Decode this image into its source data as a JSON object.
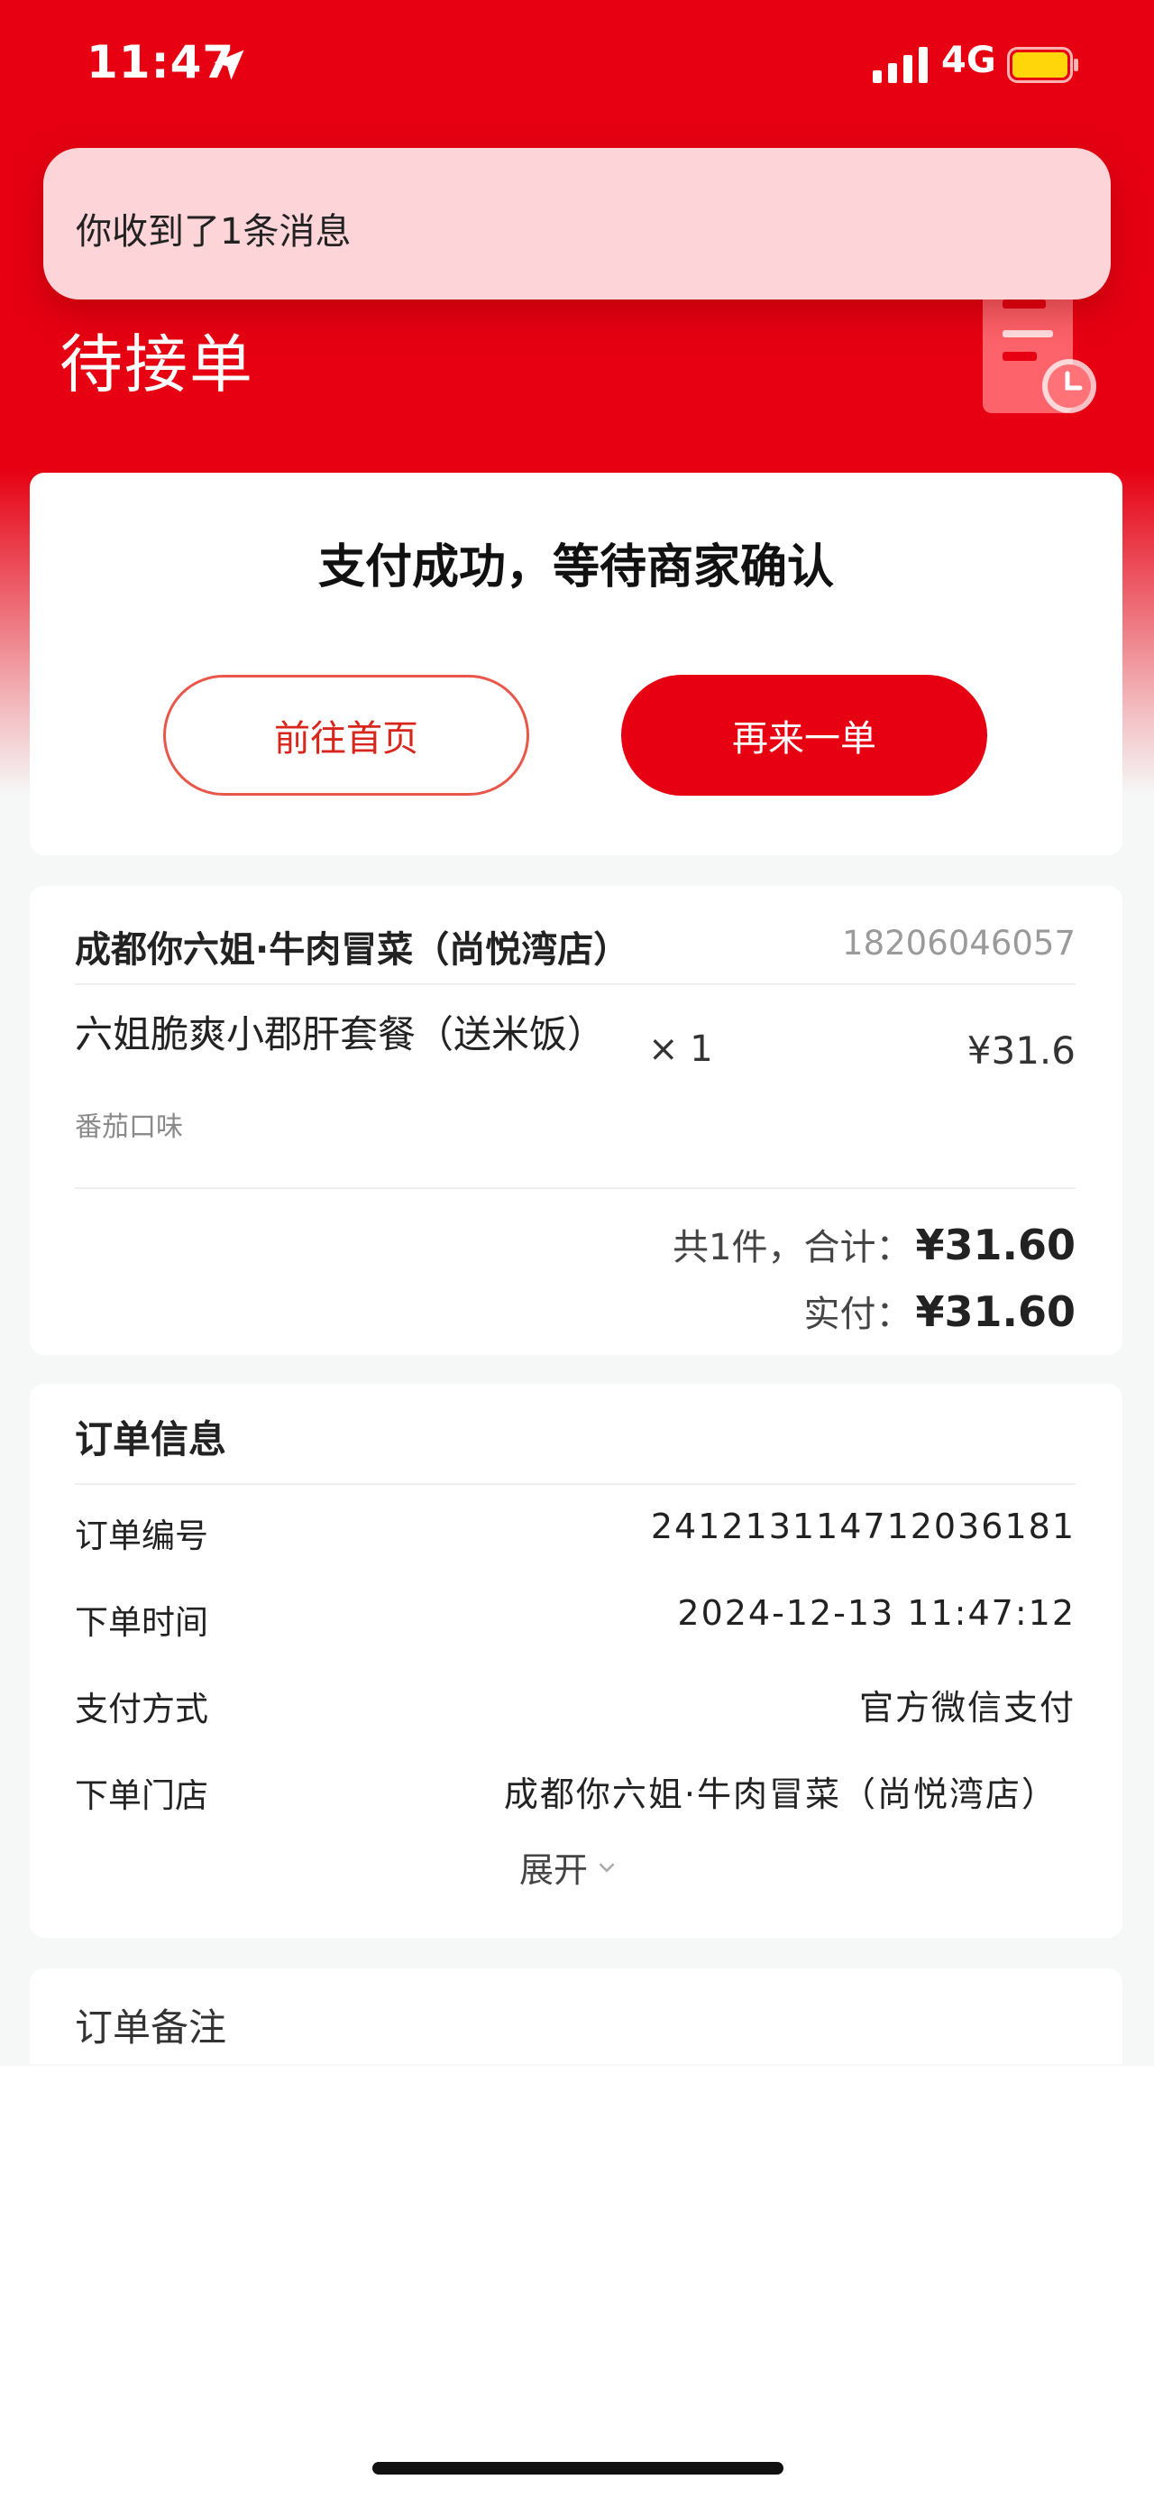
{
  "status_bar": {
    "time": "11:47",
    "network": "4G"
  },
  "notification": {
    "text": "你收到了1条消息"
  },
  "header": {
    "title": "待接单"
  },
  "result_card": {
    "message": "支付成功，等待商家确认",
    "home_button": "前往首页",
    "reorder_button": "再来一单"
  },
  "order_card": {
    "store_name": "成都你六姐·牛肉冒菜（尚悦湾店）",
    "store_phone": "18206046057",
    "items": [
      {
        "name": "六姐脆爽小郡肝套餐（送米饭）",
        "spec": "番茄口味",
        "qty": "× 1",
        "price": "¥31.6"
      }
    ],
    "total_label": "共1件，合计：",
    "total_amount": "¥31.60",
    "paid_label": "实付：",
    "paid_amount": "¥31.60"
  },
  "order_info": {
    "title": "订单信息",
    "rows": [
      {
        "label": "订单编号",
        "value": "241213114712036181"
      },
      {
        "label": "下单时间",
        "value": "2024-12-13 11:47:12"
      },
      {
        "label": "支付方式",
        "value": "官方微信支付"
      },
      {
        "label": "下单门店",
        "value": "成都你六姐·牛肉冒菜（尚悦湾店）"
      }
    ],
    "expand_label": "展开"
  },
  "remark": {
    "title": "订单备注"
  },
  "colors": {
    "brand_red": "#e60012",
    "page_bg": "#f6f7f7"
  },
  "icons": [
    "location-arrow-icon",
    "signal-icon",
    "battery-icon",
    "chevron-down-icon"
  ]
}
